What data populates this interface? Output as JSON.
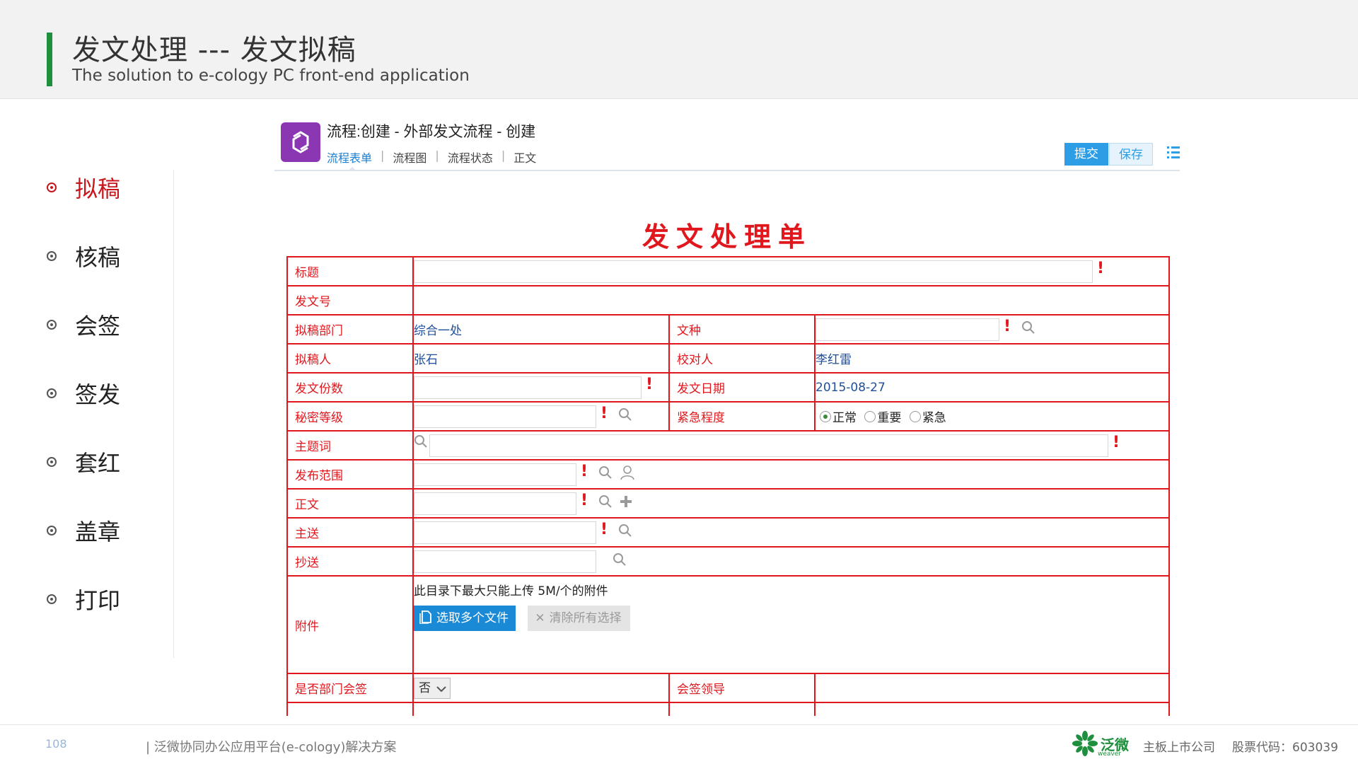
{
  "slide": {
    "title": "发文处理 --- 发文拟稿",
    "subtitle": "The solution to e-cology PC front-end application",
    "accent_color": "#1e8f3c"
  },
  "steps": [
    {
      "label": "拟稿",
      "active": true
    },
    {
      "label": "核稿",
      "active": false
    },
    {
      "label": "会签",
      "active": false
    },
    {
      "label": "签发",
      "active": false
    },
    {
      "label": "套红",
      "active": false
    },
    {
      "label": "盖章",
      "active": false
    },
    {
      "label": "打印",
      "active": false
    }
  ],
  "app": {
    "title": "流程:创建 - 外部发文流程 - 创建",
    "tabs": [
      "流程表单",
      "流程图",
      "流程状态",
      "正文"
    ],
    "submit_label": "提交",
    "save_label": "保存"
  },
  "form": {
    "title": "发文处理单",
    "labels": {
      "title": "标题",
      "doc_no": "发文号",
      "dept": "拟稿部门",
      "doc_type": "文种",
      "drafter": "拟稿人",
      "proofreader": "校对人",
      "copies": "发文份数",
      "date": "发文日期",
      "secret": "秘密等级",
      "urgency": "紧急程度",
      "keywords": "主题词",
      "scope": "发布范围",
      "body": "正文",
      "to": "主送",
      "cc": "抄送",
      "attachment": "附件",
      "dept_sign": "是否部门会签",
      "sign_leader": "会签领导"
    },
    "values": {
      "dept": "综合一处",
      "drafter": "张石",
      "proofreader": "李红雷",
      "date": "2015-08-27",
      "dept_sign": "否"
    },
    "urgency_options": [
      "正常",
      "重要",
      "紧急"
    ],
    "urgency_selected": "正常",
    "attachment_note": "此目录下最大只能上传 5M/个的附件",
    "select_files_label": "选取多个文件",
    "clear_label": "清除所有选择"
  },
  "footer": {
    "page_number": "108",
    "text": "| 泛微协同办公应用平台(e-cology)解决方案",
    "brand": "泛微",
    "brand_sub": "weaver",
    "listing": "主板上市公司",
    "stock": "股票代码：603039"
  }
}
